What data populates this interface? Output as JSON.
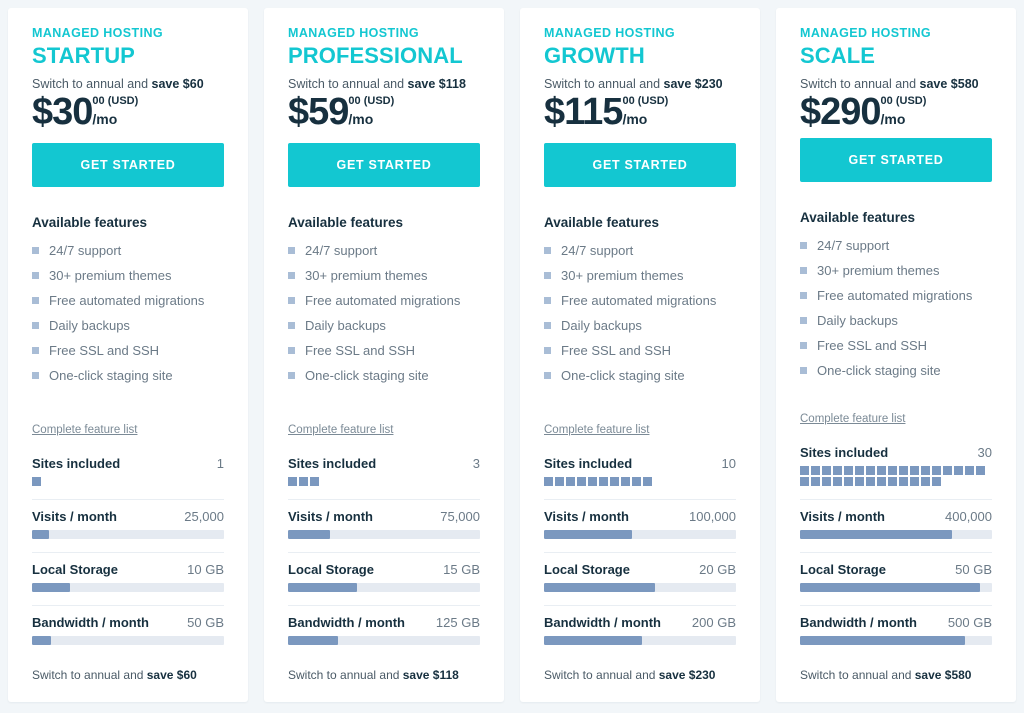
{
  "common": {
    "eyebrow": "MANAGED HOSTING",
    "cta_label": "GET STARTED",
    "features_title": "Available features",
    "feature_link": "Complete feature list",
    "currency_symbol": "$",
    "cents": "00 (USD)",
    "period": "/mo",
    "annual_prefix": "Switch to annual and ",
    "metric_labels": {
      "sites": "Sites included",
      "visits": "Visits / month",
      "storage": "Local Storage",
      "bandwidth": "Bandwidth / month"
    },
    "features": [
      "24/7 support",
      "30+ premium themes",
      "Free automated migrations",
      "Daily backups",
      "Free SSL and SSH",
      "One-click staging site"
    ],
    "colors": {
      "brand_teal": "#13c7d1",
      "price_navy": "#17303f",
      "bar_fill": "#7b98bf",
      "bar_track": "#e5eaf1",
      "page_bg": "#f2f6f9",
      "bullet": "#a9bdd6"
    }
  },
  "plans": [
    {
      "name": "STARTUP",
      "price": "30",
      "save": "save $60",
      "sites_value": "1",
      "sites_count": 1,
      "visits_value": "25,000",
      "visits_pct": 9,
      "storage_value": "10 GB",
      "storage_pct": 20,
      "bandwidth_value": "50 GB",
      "bandwidth_pct": 10
    },
    {
      "name": "PROFESSIONAL",
      "price": "59",
      "save": "save $118",
      "sites_value": "3",
      "sites_count": 3,
      "visits_value": "75,000",
      "visits_pct": 22,
      "storage_value": "15 GB",
      "storage_pct": 36,
      "bandwidth_value": "125 GB",
      "bandwidth_pct": 26
    },
    {
      "name": "GROWTH",
      "price": "115",
      "save": "save $230",
      "sites_value": "10",
      "sites_count": 10,
      "visits_value": "100,000",
      "visits_pct": 46,
      "storage_value": "20 GB",
      "storage_pct": 58,
      "bandwidth_value": "200 GB",
      "bandwidth_pct": 51
    },
    {
      "name": "SCALE",
      "price": "290",
      "save": "save $580",
      "sites_value": "30",
      "sites_count": 30,
      "visits_value": "400,000",
      "visits_pct": 79,
      "storage_value": "50 GB",
      "storage_pct": 94,
      "bandwidth_value": "500 GB",
      "bandwidth_pct": 86
    }
  ]
}
